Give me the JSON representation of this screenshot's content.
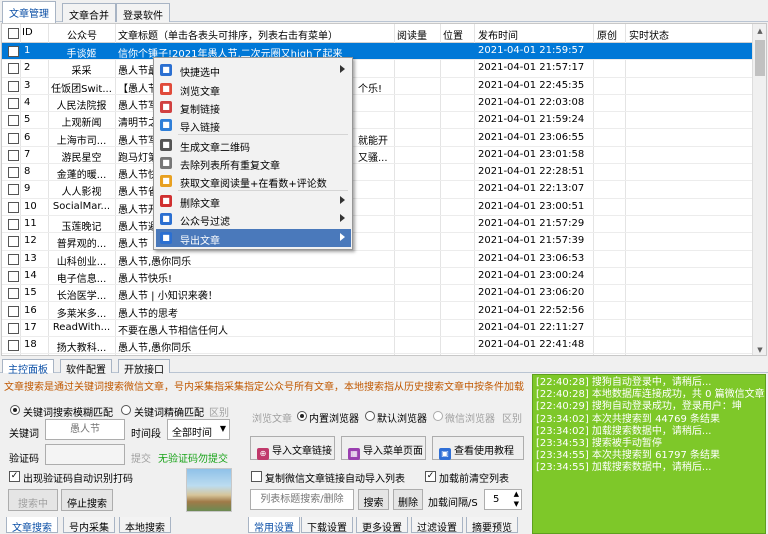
{
  "top_tabs": [
    "文章管理",
    "文章合并",
    "登录软件"
  ],
  "columns": {
    "id": "ID",
    "account": "公众号",
    "title": "文章标题（单击各表头可排序，列表右击有菜单）",
    "reads": "阅读量",
    "position": "位置",
    "time": "发布时间",
    "original": "原创",
    "status": "实时状态"
  },
  "rows": [
    {
      "id": "1",
      "account": "手谈姬",
      "title": "信你个锤子!2021年愚人节,二次元圈又high了起来",
      "time": "2021-04-01 21:59:57",
      "selected": true
    },
    {
      "id": "2",
      "account": "采采",
      "title": "愚人节最",
      "time": "2021-04-01 21:57:17"
    },
    {
      "id": "3",
      "account": "任饭团Swit...",
      "title": "【愚人节",
      "title_tail": "个乐!",
      "time": "2021-04-01 22:45:35"
    },
    {
      "id": "4",
      "account": "人民法院报",
      "title": "愚人节写",
      "time": "2021-04-01 22:03:08"
    },
    {
      "id": "5",
      "account": "上观新闻",
      "title": "清明节之",
      "time": "2021-04-01 21:59:24"
    },
    {
      "id": "6",
      "account": "上海市司...",
      "title": "愚人节写",
      "title_tail": "就能开",
      "time": "2021-04-01 23:06:55"
    },
    {
      "id": "7",
      "account": "游民星空",
      "title": "跑马灯第",
      "title_tail": "又骚...",
      "time": "2021-04-01 23:01:58"
    },
    {
      "id": "8",
      "account": "金蓬的暖...",
      "title": "愚人节快",
      "time": "2021-04-01 22:28:51"
    },
    {
      "id": "9",
      "account": "人人影视",
      "title": "愚人节省",
      "time": "2021-04-01 22:13:07"
    },
    {
      "id": "10",
      "account": "SocialMar...",
      "title": "愚人节开",
      "time": "2021-04-01 23:00:51"
    },
    {
      "id": "11",
      "account": "玉莲晚记",
      "title": "愚人节避",
      "time": "2021-04-01 21:57:29"
    },
    {
      "id": "12",
      "account": "普昇观的...",
      "title": "愚人节",
      "time": "2021-04-01 21:57:39"
    },
    {
      "id": "13",
      "account": "山科创业...",
      "title": "愚人节,愚你同乐",
      "time": "2021-04-01 23:06:53"
    },
    {
      "id": "14",
      "account": "电子信息...",
      "title": "愚人节快乐!",
      "time": "2021-04-01 23:00:24"
    },
    {
      "id": "15",
      "account": "长治医学...",
      "title": "愚人节 | 小知识来袭！",
      "time": "2021-04-01 23:06:20"
    },
    {
      "id": "16",
      "account": "多莱米多...",
      "title": "愚人节的思考",
      "time": "2021-04-01 22:52:56"
    },
    {
      "id": "17",
      "account": "ReadWith...",
      "title": "不要在愚人节相信任何人",
      "time": "2021-04-01 22:11:27"
    },
    {
      "id": "18",
      "account": "扬大教科...",
      "title": "愚人节,愚你同乐",
      "time": "2021-04-01 22:41:48"
    }
  ],
  "context_menu": [
    {
      "label": "快捷选中",
      "icon": "quick-select-icon",
      "color": "#2b6fd1",
      "submenu": true
    },
    {
      "label": "浏览文章",
      "icon": "chrome-icon",
      "color": "#e04a3a"
    },
    {
      "label": "复制链接",
      "icon": "copy-link-icon",
      "color": "#d04040"
    },
    {
      "label": "导入链接",
      "icon": "import-link-icon",
      "color": "#2f7fd8"
    },
    {
      "label": "生成文章二维码",
      "icon": "qrcode-icon",
      "color": "#555555"
    },
    {
      "label": "去除列表所有重复文章",
      "icon": "dedupe-icon",
      "color": "#777777"
    },
    {
      "label": "获取文章阅读量+在看数+评论数",
      "icon": "stats-icon",
      "color": "#e8a020"
    },
    {
      "label": "删除文章",
      "icon": "trash-icon",
      "color": "#d03030",
      "submenu": true
    },
    {
      "label": "公众号过滤",
      "icon": "filter-icon",
      "color": "#2b6fd1",
      "submenu": true
    },
    {
      "label": "导出文章",
      "icon": "export-icon",
      "color": "#2b6fd1",
      "submenu": true,
      "highlighted": true
    }
  ],
  "bottom_tabs": [
    "主控面板",
    "软件配置",
    "开放接口"
  ],
  "info": "文章搜索是通过关键词搜索微信文章，号内采集指采集指定公众号所有文章，本地搜索指从历史搜索文章中按条件加载",
  "search": {
    "fuzzy": "关键词搜索模糊匹配",
    "exact": "关键词精确匹配",
    "range": "区别",
    "keyword_label": "关键词",
    "keyword_placeholder": "愚人节",
    "period_label": "时间段",
    "period_value": "全部时间",
    "captcha_label": "验证码",
    "submit_label": "提交",
    "nocaptcha": "无验证码勿提交",
    "auto_captcha": "出现验证码自动识别打码",
    "searching": "搜索中",
    "stop": "停止搜索"
  },
  "left_subtabs": [
    "文章搜索",
    "号内采集",
    "本地搜索"
  ],
  "browse": {
    "label": "浏览文章",
    "builtin": "内置浏览器",
    "default": "默认浏览器",
    "wechat": "微信浏览器",
    "range": "区别"
  },
  "actions": {
    "import_link": "导入文章链接",
    "import_menu": "导入菜单页面",
    "help": "查看使用教程"
  },
  "options": {
    "copy_auto": "复制微信文章链接自动导入列表",
    "clear_list": "加载前清空列表",
    "filter_placeholder": "列表标题搜索/删除",
    "search": "搜索",
    "delete": "删除",
    "interval_label": "加载间隔/S",
    "interval_value": "5"
  },
  "right_subtabs": [
    "常用设置",
    "下载设置",
    "更多设置",
    "过滤设置",
    "摘要预览"
  ],
  "log": [
    "[22:40:28] 搜狗自动登录中，请稍后...",
    "[22:40:28] 本地数据库连接成功，共 0 篇微信文章...",
    "[22:40:29] 搜狗自动登录成功，登录用户：坤",
    "[23:34:02] 本次共搜索到 44769 条结果",
    "[23:34:02] 加载搜索数据中，请稍后...",
    "[23:34:53] 搜索被手动暂停",
    "[23:34:55] 本次共搜索到 61797 条结果",
    "[23:34:55] 加载搜索数据中，请稍后..."
  ]
}
